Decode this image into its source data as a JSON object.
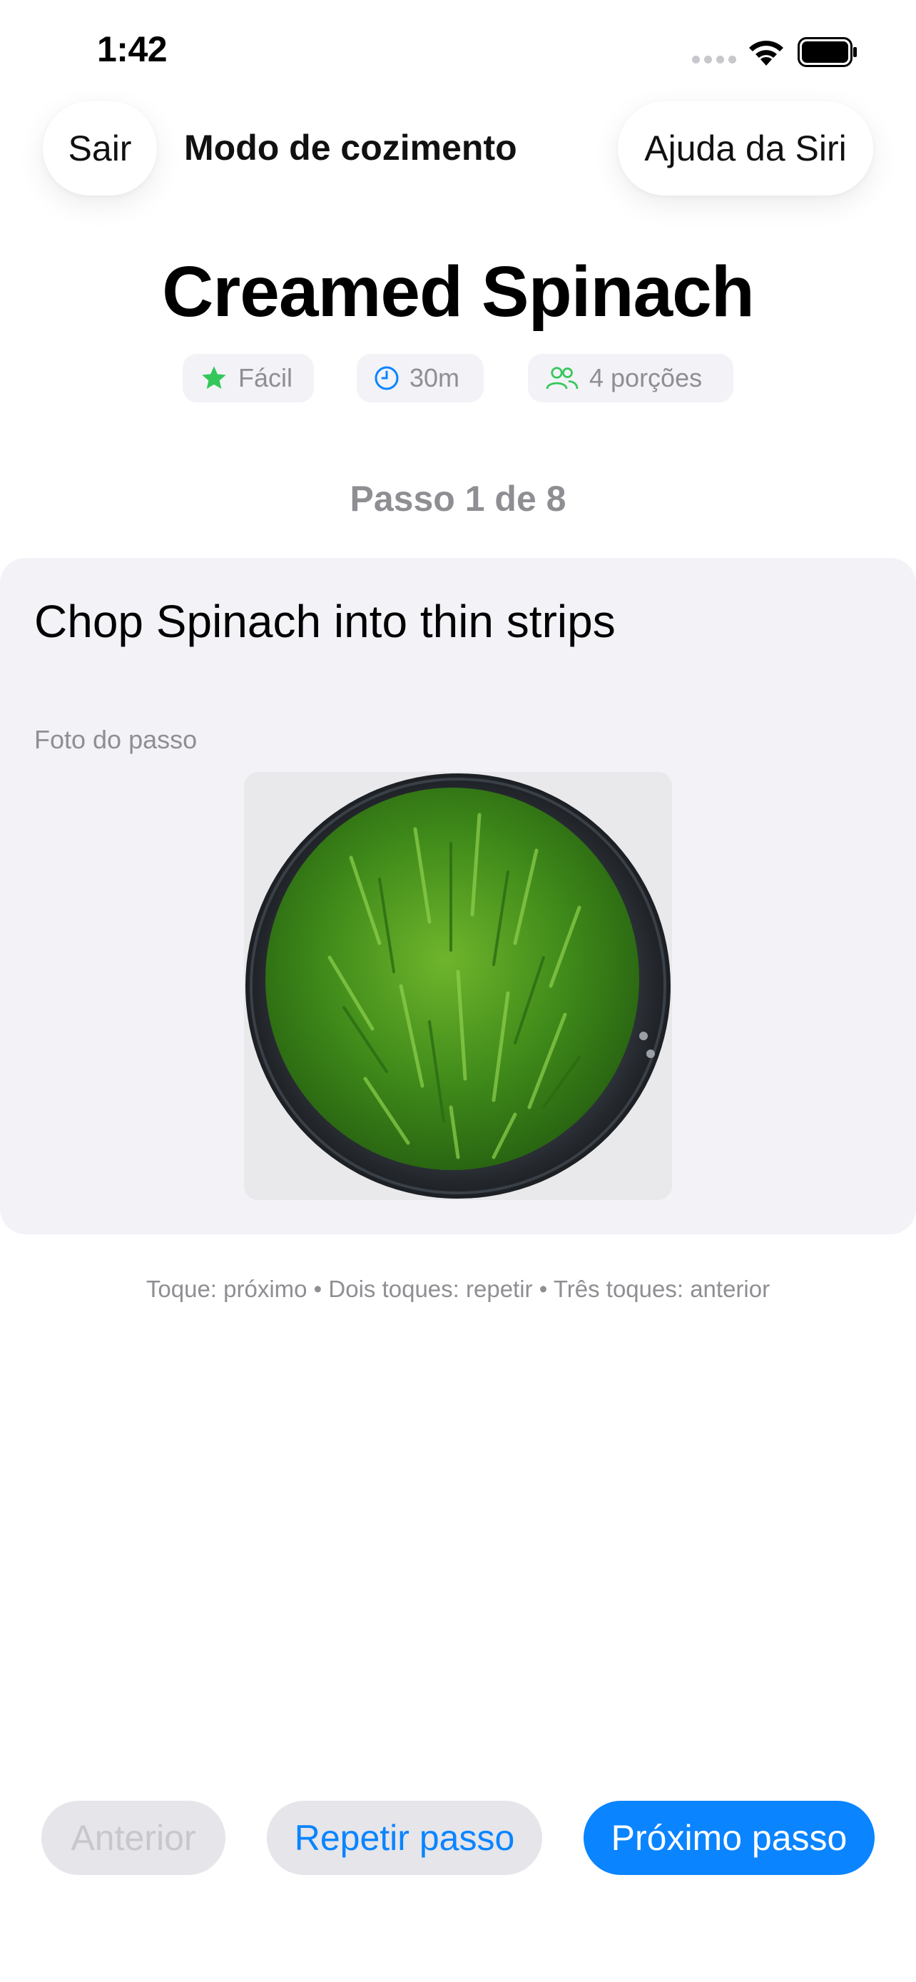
{
  "status_bar": {
    "time": "1:42"
  },
  "header": {
    "exit_label": "Sair",
    "title": "Modo de cozimento",
    "siri_label": "Ajuda da Siri"
  },
  "recipe": {
    "title": "Creamed Spinach",
    "difficulty": "Fácil",
    "time": "30m",
    "servings": "4 porções"
  },
  "step": {
    "counter": "Passo 1 de 8",
    "text": "Chop Spinach into thin strips",
    "photo_label": "Foto do passo"
  },
  "gesture_hint": "Toque: próximo • Dois toques: repetir • Três toques: anterior",
  "buttons": {
    "previous": "Anterior",
    "repeat": "Repetir passo",
    "next": "Próximo passo"
  },
  "icons": {
    "difficulty": "star-icon",
    "time": "clock-icon",
    "servings": "people-icon"
  },
  "colors": {
    "accent": "#0a84ff",
    "star": "#34c759",
    "clock": "#0a84ff",
    "people": "#34c759",
    "card_background": "#f2f2f7",
    "secondary_text": "#8e8e93"
  }
}
